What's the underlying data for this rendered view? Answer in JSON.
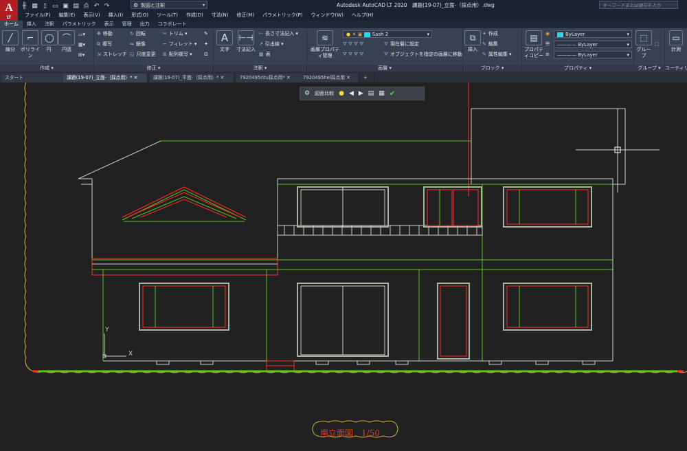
{
  "app": {
    "logo": "A",
    "logo_sub": "LT",
    "window_title": "Autodesk AutoCAD LT 2020　課題(19-07)_立面-（採点用）.dwg"
  },
  "workspace": {
    "label": "製図と注釈"
  },
  "search": {
    "placeholder": "キーワードまたは語句を入力"
  },
  "menu": [
    "ファイル(F)",
    "編集(E)",
    "表示(V)",
    "挿入(I)",
    "形式(O)",
    "ツール(T)",
    "作成(D)",
    "寸法(N)",
    "修正(M)",
    "パラメトリック(P)",
    "ウィンドウ(W)",
    "ヘルプ(H)"
  ],
  "ribbon_tabs": [
    "ホーム",
    "挿入",
    "注釈",
    "パラメトリック",
    "表示",
    "管理",
    "出力",
    "コラボレート"
  ],
  "panels": {
    "draw": {
      "label": "作成 ▾",
      "line": "線分",
      "polyline": "ポリライン",
      "circle": "円",
      "arc": "円弧"
    },
    "modify": {
      "label": "修正 ▾",
      "move": "移動",
      "copy": "複写",
      "stretch": "ストレッチ",
      "rotate": "回転",
      "mirror": "鏡像",
      "scale": "尺度変更",
      "trim": "トリム",
      "fillet": "フィレット",
      "array": "配列複写"
    },
    "annotation": {
      "label": "注釈 ▾",
      "text": "文字",
      "dimension": "寸法記入",
      "linear": "長さ寸法記入",
      "leader": "引出線",
      "table": "表"
    },
    "layers": {
      "label": "画層 ▾",
      "properties": "画層プロパティ管理",
      "current_layer": "Sash 2",
      "make_current": "現在層に設定",
      "match_layer": "オブジェクトを指定の画層に移動"
    },
    "block": {
      "label": "ブロック ▾",
      "insert": "挿入",
      "create": "作成",
      "edit": "編集",
      "attr_edit": "属性編集"
    },
    "properties": {
      "label": "プロパティ ▾",
      "match": "プロパティコピー",
      "color": "ByLayer",
      "linetype": "ByLayer",
      "lineweight": "ByLayer"
    },
    "groups": {
      "label": "グループ ▾",
      "group": "グループ"
    },
    "utilities": {
      "label": "ユーティリティ",
      "measure": "計測"
    }
  },
  "doc_tabs": [
    "スタート",
    "課題(19-07)_立面-（採点用）*",
    "課題(19-07)_平面-（採点用）*",
    "7920495ritu採点用*",
    "7920495hei採点用"
  ],
  "nav_toolbar": {
    "compare": "図面比較"
  },
  "drawing": {
    "title": "南立面図　1/50",
    "ucs_x": "X",
    "ucs_y": "Y"
  },
  "colors": {
    "background": "#212121",
    "accent_red": "#b11d22",
    "layer_color": "#31d6e6",
    "line_green": "#5dc21e",
    "line_red": "#ff2a2a",
    "line_white": "#cfcfcf",
    "title_red": "#e13a2a"
  }
}
